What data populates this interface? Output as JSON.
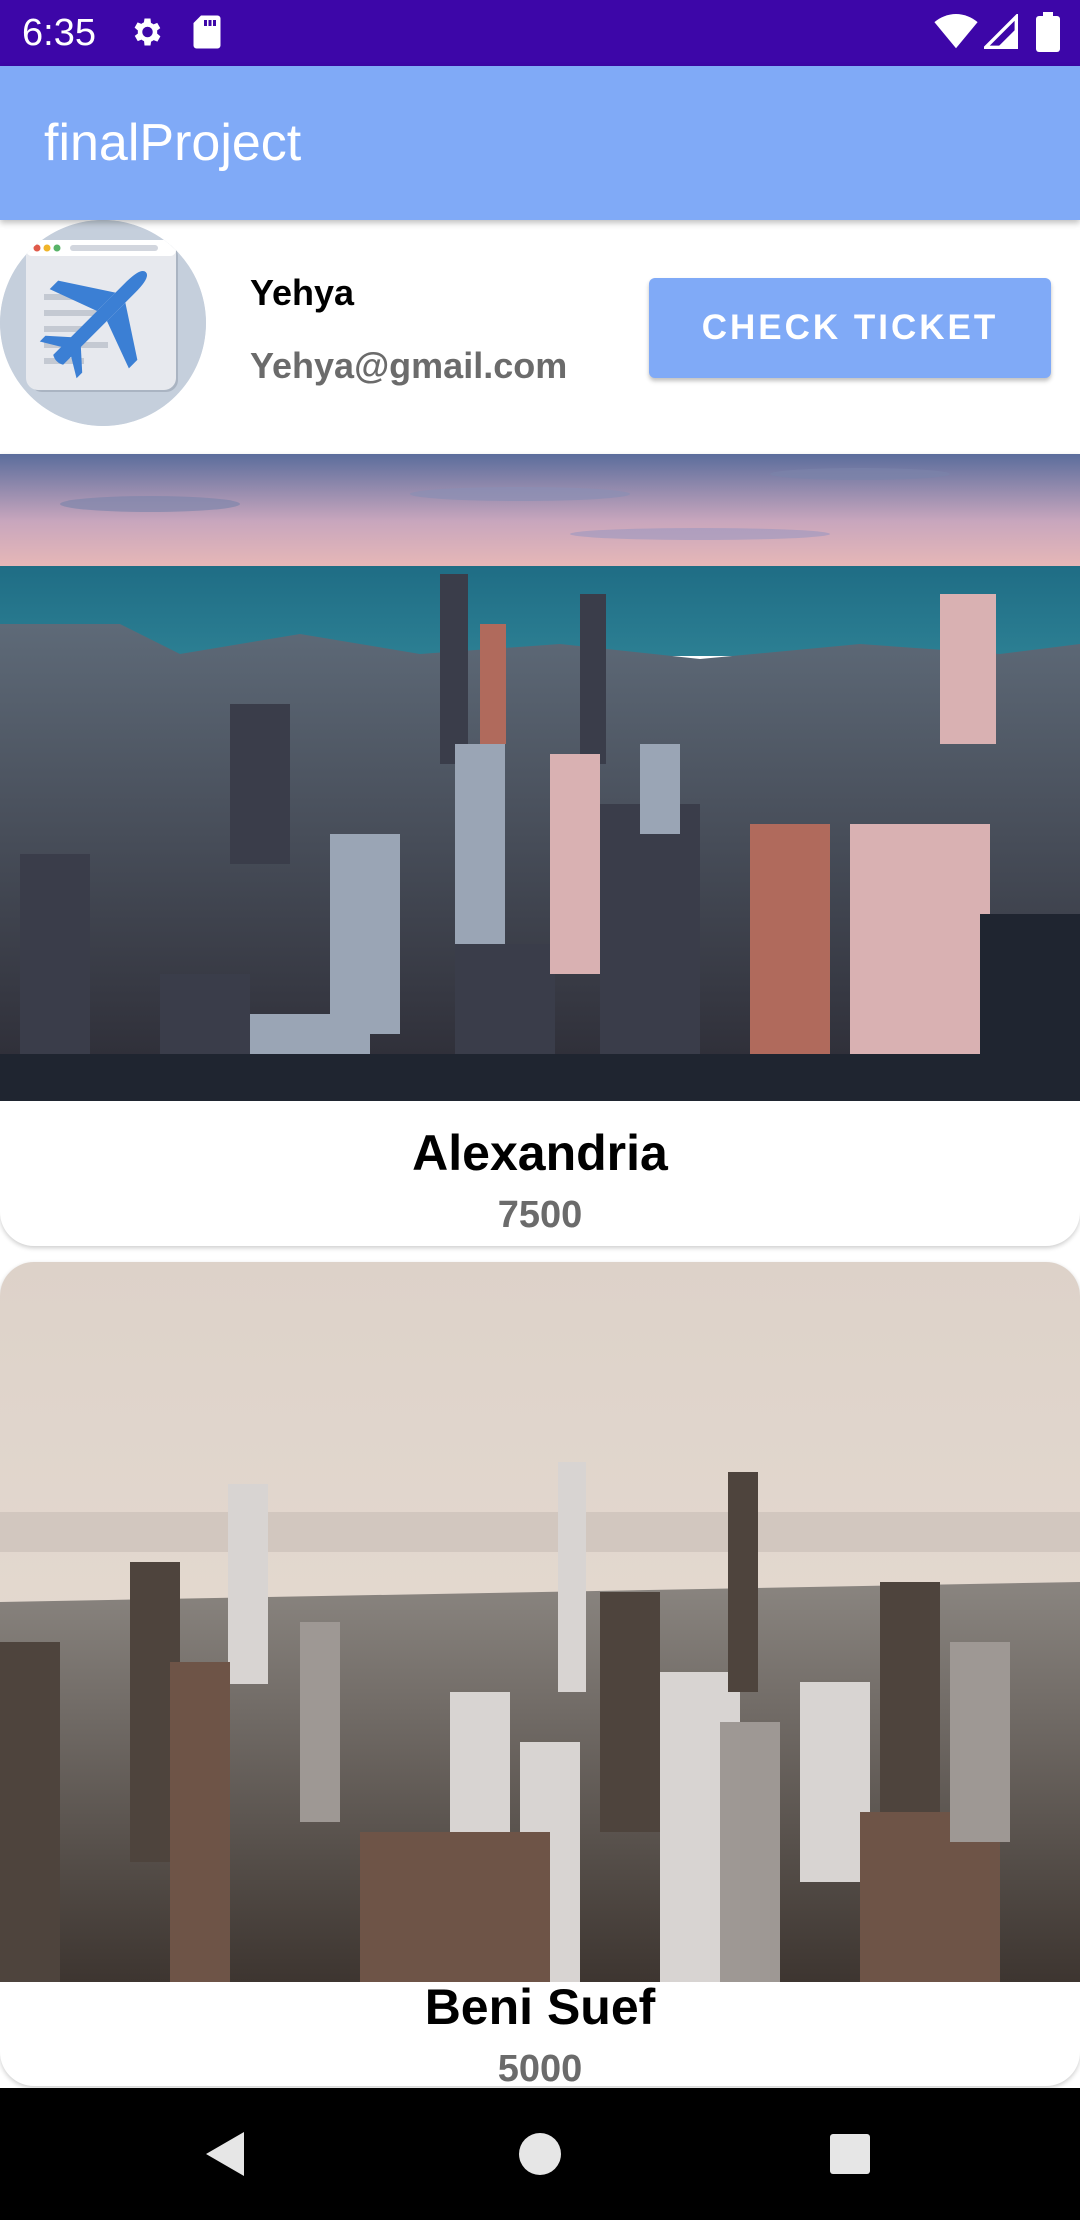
{
  "status_bar": {
    "time": "6:35",
    "icons": [
      "settings-icon",
      "sd-card-icon",
      "wifi-icon",
      "signal-icon",
      "battery-icon"
    ]
  },
  "app_bar": {
    "title": "finalProject"
  },
  "profile": {
    "name": "Yehya",
    "email": "Yehya@gmail.com",
    "check_ticket_label": "CHECK TICKET"
  },
  "destinations": [
    {
      "name": "Alexandria",
      "price": "7500"
    },
    {
      "name": "Beni Suef",
      "price": "5000"
    }
  ],
  "nav_bar": {
    "buttons": [
      "back-icon",
      "home-icon",
      "recents-icon"
    ]
  },
  "colors": {
    "status_bar": "#3d06a8",
    "app_bar": "#80aaf7",
    "button": "#80aaf7",
    "secondary_text": "#6b6b6b"
  }
}
